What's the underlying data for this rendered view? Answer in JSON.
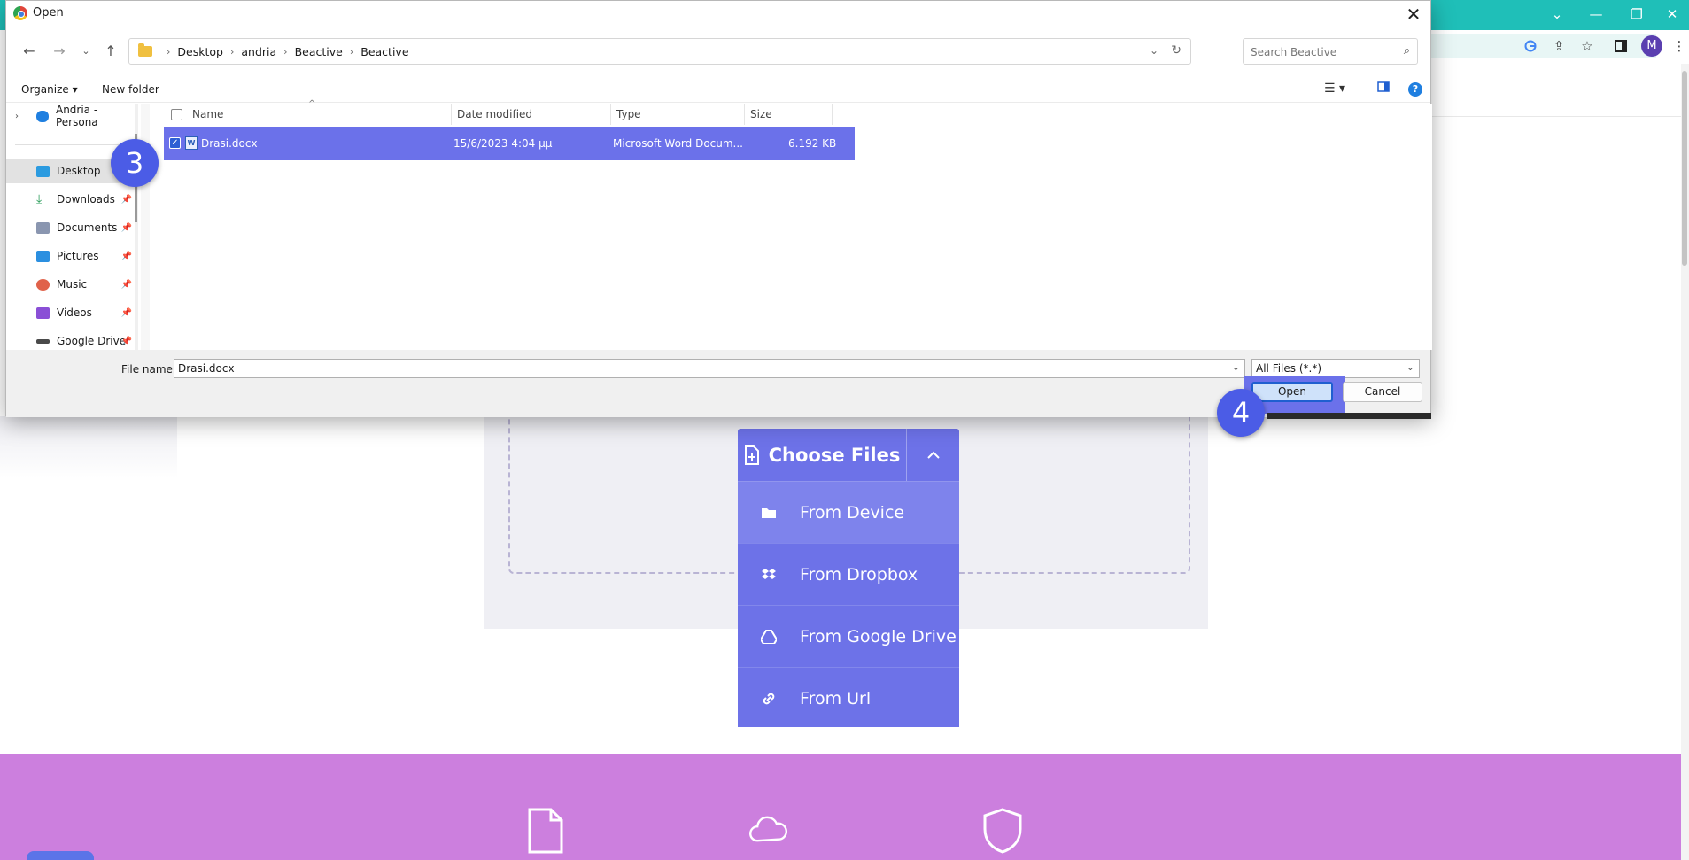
{
  "dialog": {
    "title": "Open",
    "breadcrumb": [
      "Desktop",
      "andria",
      "Beactive",
      "Beactive"
    ],
    "search_placeholder": "Search Beactive",
    "organize_label": "Organize ▾",
    "new_folder_label": "New folder",
    "columns": {
      "name": "Name",
      "date": "Date modified",
      "type": "Type",
      "size": "Size"
    },
    "nav_items": [
      {
        "label": "Andria - Persona",
        "pinned": false
      },
      {
        "label": "Desktop",
        "pinned": false
      },
      {
        "label": "Downloads",
        "pinned": true
      },
      {
        "label": "Documents",
        "pinned": true
      },
      {
        "label": "Pictures",
        "pinned": true
      },
      {
        "label": "Music",
        "pinned": true
      },
      {
        "label": "Videos",
        "pinned": true
      },
      {
        "label": "Google Drive",
        "pinned": true
      }
    ],
    "files": [
      {
        "name": "Drasi.docx",
        "date": "15/6/2023 4:04 μμ",
        "type": "Microsoft Word Docum...",
        "size": "6.192 KB",
        "selected": true
      }
    ],
    "file_name_label": "File name:",
    "file_name_value": "Drasi.docx",
    "file_type_value": "All Files (*.*)",
    "open_label": "Open",
    "cancel_label": "Cancel"
  },
  "upload": {
    "choose_files_label": "Choose Files",
    "menu": [
      {
        "label": "From Device",
        "icon": "folder-icon",
        "active": true
      },
      {
        "label": "From Dropbox",
        "icon": "dropbox-icon",
        "active": false
      },
      {
        "label": "From Google Drive",
        "icon": "google-drive-icon",
        "active": false
      },
      {
        "label": "From Url",
        "icon": "link-icon",
        "active": false
      }
    ]
  },
  "browser": {
    "avatar_letter": "M"
  },
  "badges": {
    "step3": "3",
    "step4": "4"
  },
  "colors": {
    "accent": "#6d72e8",
    "selection": "#6b71ea",
    "band": "#cc7fde",
    "chrome": "#1fbfb8"
  }
}
